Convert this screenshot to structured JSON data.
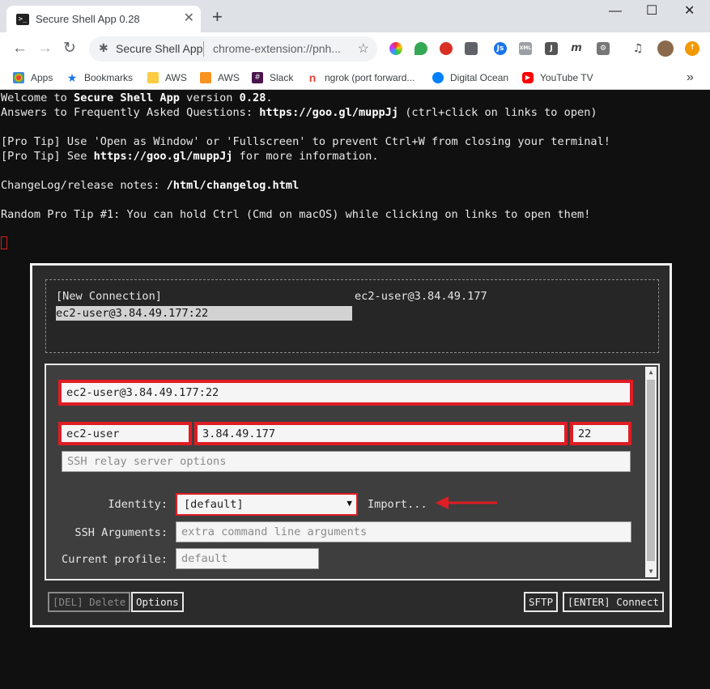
{
  "window": {
    "tab_title": "Secure Shell App 0.28",
    "tab_close": "✕",
    "new_tab": "+",
    "minimize": "—",
    "maximize": "☐",
    "close": "✕"
  },
  "toolbar": {
    "back": "←",
    "forward": "→",
    "reload": "↻",
    "site_name": "Secure Shell App",
    "url": "chrome-extension://pnh...",
    "star": "☆",
    "menu": "⋮"
  },
  "bookmarks": [
    {
      "label": "Apps",
      "icon": "apps-grid-icon"
    },
    {
      "label": "Bookmarks",
      "icon": "star-icon"
    },
    {
      "label": "AWS",
      "icon": "folder-icon"
    },
    {
      "label": "AWS",
      "icon": "aws-cube-icon"
    },
    {
      "label": "Slack",
      "icon": "slack-icon"
    },
    {
      "label": "ngrok (port forward...",
      "icon": "ngrok-icon"
    },
    {
      "label": "Digital Ocean",
      "icon": "digital-ocean-icon"
    },
    {
      "label": "YouTube TV",
      "icon": "youtube-icon"
    }
  ],
  "bookmarks_overflow": "»",
  "terminal": {
    "l1_a": "Welcome to ",
    "l1_b": "Secure Shell App",
    "l1_c": " version ",
    "l1_d": "0.28",
    "l1_e": ".",
    "l2_a": "Answers to Frequently Asked Questions: ",
    "l2_b": "https://goo.gl/muppJj",
    "l2_c": " (ctrl+click on links to open)",
    "l3": "[Pro Tip] Use 'Open as Window' or 'Fullscreen' to prevent Ctrl+W from closing your terminal!",
    "l4_a": "[Pro Tip] See ",
    "l4_b": "https://goo.gl/muppJj",
    "l4_c": " for more information.",
    "l5_a": "ChangeLog/release notes: ",
    "l5_b": "/html/changelog.html",
    "l6": "Random Pro Tip #1: You can hold Ctrl (Cmd on macOS) while clicking on links to open them!"
  },
  "dialog": {
    "profiles": {
      "new_connection": "[New Connection]",
      "selected": "ec2-user@3.84.49.177:22",
      "right_label": "ec2-user@3.84.49.177"
    },
    "form": {
      "destination": "ec2-user@3.84.49.177:22",
      "username": "ec2-user",
      "hostname": "3.84.49.177",
      "port": "22",
      "relay_placeholder": "SSH relay server options",
      "identity_label": "Identity:",
      "identity_value": "[default]",
      "import_label": "Import...",
      "ssh_args_label": "SSH Arguments:",
      "ssh_args_placeholder": "extra command line arguments",
      "profile_label": "Current profile:",
      "profile_placeholder": "default"
    },
    "buttons": {
      "delete": "[DEL] Delete",
      "options": "Options",
      "sftp": "SFTP",
      "connect": "[ENTER] Connect"
    }
  },
  "colors": {
    "highlight_red": "#e01c24",
    "terminal_bg": "#101010"
  }
}
